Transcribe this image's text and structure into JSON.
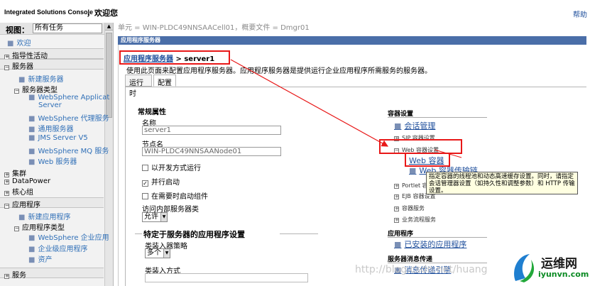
{
  "topbar": {
    "brand": "Integrated Solutions Console",
    "welcome": "，欢迎您",
    "help": "帮助"
  },
  "nav": {
    "view_label": "视图：",
    "view_value": "所有任务",
    "welcome_link": "欢迎",
    "guided": "指导性活动",
    "servers": "服务器",
    "new_server": "新建服务器",
    "server_types": "服务器类型",
    "was_app_server_1": "WebSphere Applicat",
    "was_app_server_2": "Server",
    "was_proxy": "WebSphere 代理服务",
    "generic_server": "通用服务器",
    "jms_server": "JMS Server V5",
    "mq_server": "WebSphere MQ 服务",
    "web_server": "Web 服务器",
    "cluster": "集群",
    "datapower": "DataPower",
    "core_group": "核心组",
    "applications": "应用程序",
    "new_app": "新建应用程序",
    "app_types": "应用程序类型",
    "was_enterprise_app": "WebSphere 企业应用",
    "business_level_app": "企业级应用程序",
    "assets": "资产",
    "bottom_section": "服务"
  },
  "main": {
    "crumb": "单元 = WIN-PLDC49NNSAACell01，概要文件 = Dmgr01",
    "panel_header": "应用程序服务器",
    "bc_link": "应用程序服务器",
    "bc_current": " > server1",
    "description": "使用此页面来配置应用程序服务器。应用程序服务器是提供运行企业应用程序所需服务的服务器。",
    "tab_runtime": "运行时",
    "tab_config": "配置",
    "general_props": "常规属性",
    "name_label": "名称",
    "name_value": "server1",
    "node_label": "节点名",
    "node_value": "WIN-PLDC49NNSAANode01",
    "cb_dev_mode": "以开发方式运行",
    "cb_parallel": "并行启动",
    "cb_parallel_check": "✓",
    "cb_on_demand": "在需要时启动组件",
    "internal_access": "访问内部服务器类",
    "internal_access_value": "允许",
    "app_settings_title": "特定于服务器的应用程序设置",
    "classloader_policy_label": "类装入器策略",
    "classloader_policy_value": "多个",
    "classloading_mode_label": "类装入方式"
  },
  "right": {
    "container_settings": "容器设置",
    "session_mgmt": "会话管理",
    "sip_container": "SIP 容器设置",
    "web_container_settings": "Web 容器设置",
    "web_container": "Web 容器",
    "web_transport": "Web 容器传输链",
    "portlet": "Portlet 容器设置",
    "ejb": "EJB 容器设置",
    "container_services": "容器服务",
    "business_process": "业务流程服务",
    "applications_head": "应用程序",
    "installed_apps": "已安装的应用程序",
    "messaging_head": "服务器消息传递",
    "messaging_engines": "消息传递引擎"
  },
  "tooltip": "指定容器的线程池和动态高速缓存设置。同时，请指定会话管理器设置（如持久性和调整参数）和 HTTP 传输设置。",
  "watermark": "http://blog.csdn.net/huang",
  "logo": {
    "cn": "运维网",
    "en": "iyunvn.com"
  }
}
